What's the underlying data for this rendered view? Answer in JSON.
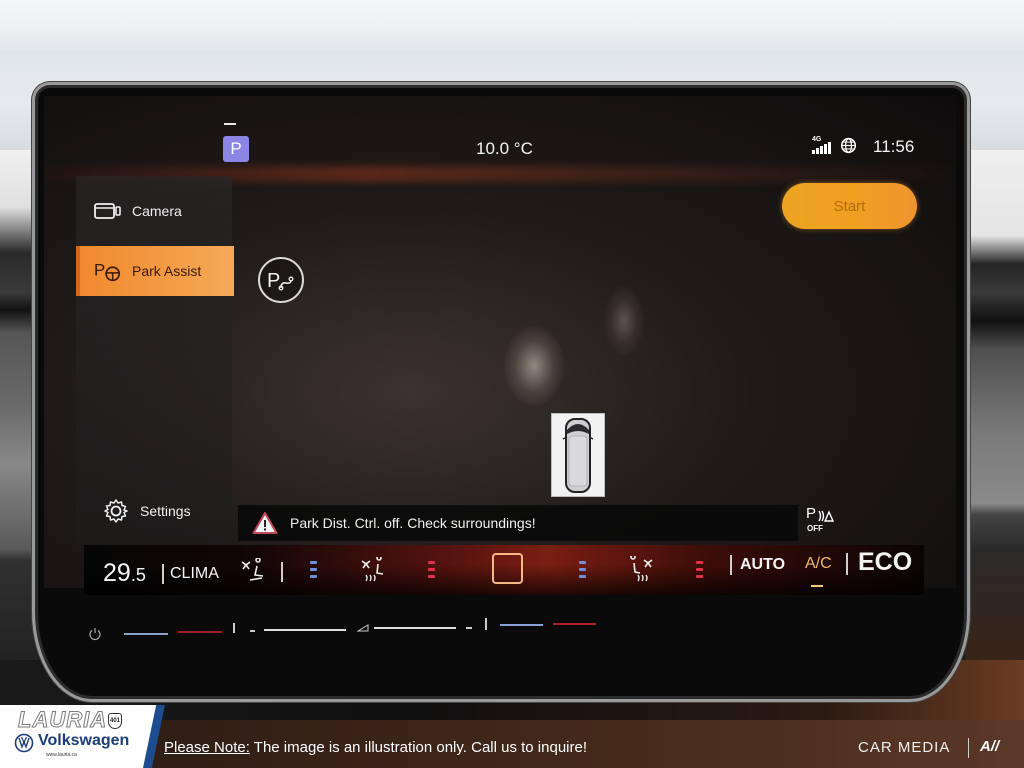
{
  "status_bar": {
    "gear": "P",
    "outside_temperature": "10.0 °C",
    "network": "4G",
    "clock": "11:56"
  },
  "sidebar": {
    "items": [
      {
        "label": "Camera",
        "icon": "camera-icon",
        "active": false
      },
      {
        "label": "Park Assist",
        "icon": "park-assist-icon",
        "active": true
      },
      {
        "label": "Settings",
        "icon": "gear-icon",
        "active": false
      }
    ]
  },
  "main": {
    "start_button": "Start",
    "warning_message": "Park Dist. Ctrl. off. Check surroundings!",
    "pdc_status": {
      "symbol": "P",
      "label": "OFF"
    }
  },
  "clima": {
    "temp_left_whole": "29",
    "temp_left_decimal": ".5",
    "label": "CLIMA",
    "auto_label": "AUTO",
    "ac_label": "A/C",
    "eco_label": "ECO",
    "colors": {
      "cool": "#6f8fd8",
      "heat": "#e0324a",
      "ac_active": "#f0b868",
      "start_button": "#eda422",
      "active_menu": "#f08a2e"
    }
  },
  "dealer": {
    "brand_line1": "LAURIA",
    "brand_line2": "Volkswagen",
    "highway": "401",
    "url": "www.lauria.ca",
    "note_lead": "Please Note:",
    "note_text": " The image is an illustration only. Call us to inquire!",
    "credit": "CAR MEDIA",
    "credit_logo": "A//"
  }
}
